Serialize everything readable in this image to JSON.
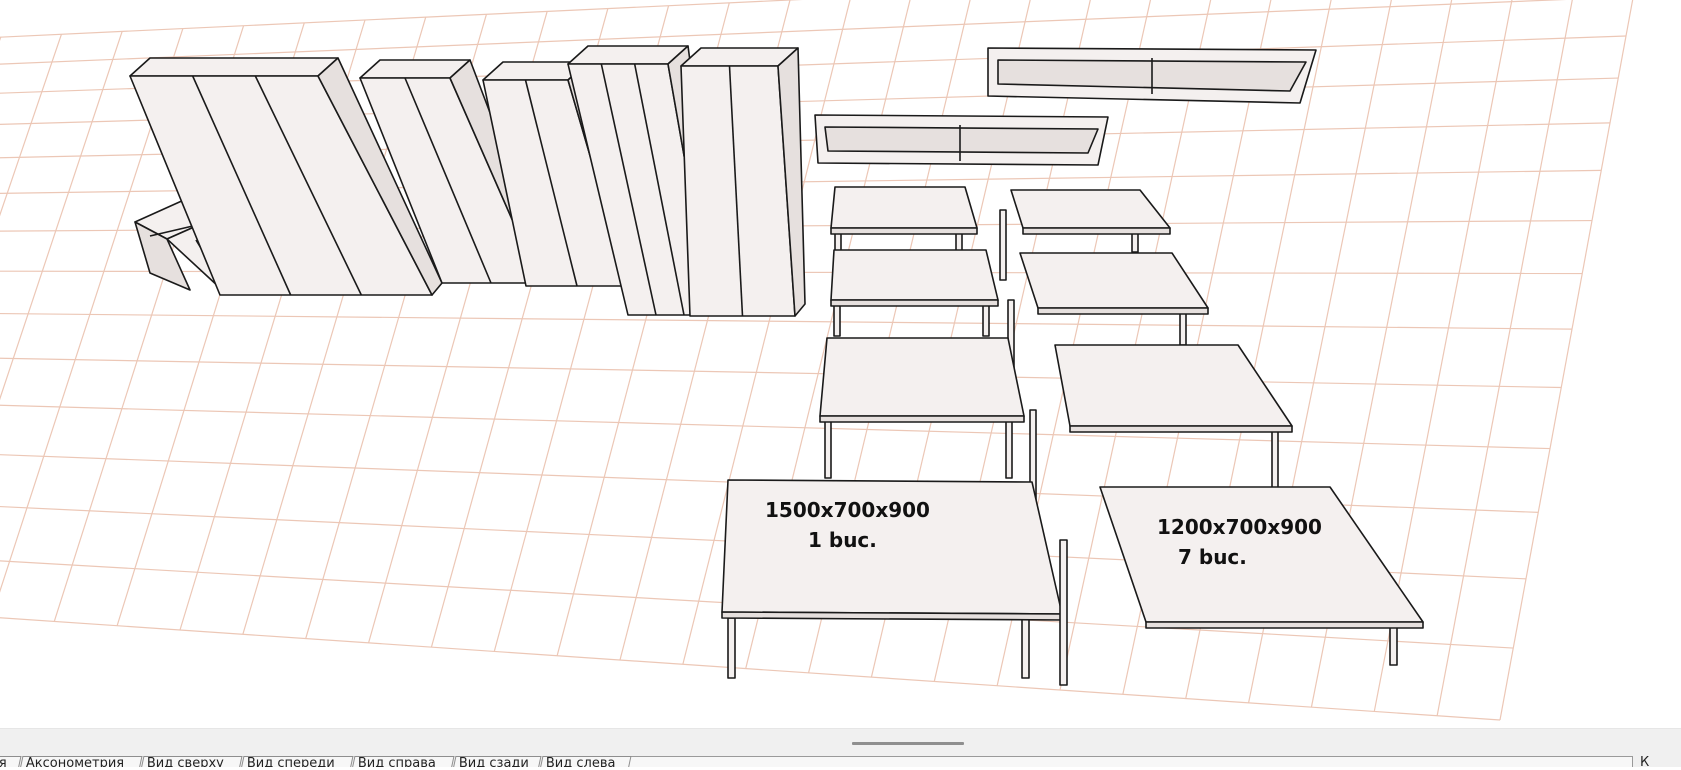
{
  "labels": [
    {
      "size": "1500x700x900",
      "count": "1 buc."
    },
    {
      "size": "1200x700x900",
      "count": "7 buc."
    }
  ],
  "tabs": [
    {
      "label": "Аксонометрия"
    },
    {
      "label": "Вид сверху"
    },
    {
      "label": "Вид спереди"
    },
    {
      "label": "Вид справа"
    },
    {
      "label": "Вид сзади"
    },
    {
      "label": "Вид слева"
    }
  ],
  "tab_left_fragment": "я",
  "tab_right_fragment": "К",
  "colors": {
    "grid": "#ecc7b6",
    "furniture_fill": "#f4f0ef",
    "furniture_shade": "#e6e0de",
    "outline": "#1a1a1a",
    "bottom_bar": "#f0f0f0"
  }
}
